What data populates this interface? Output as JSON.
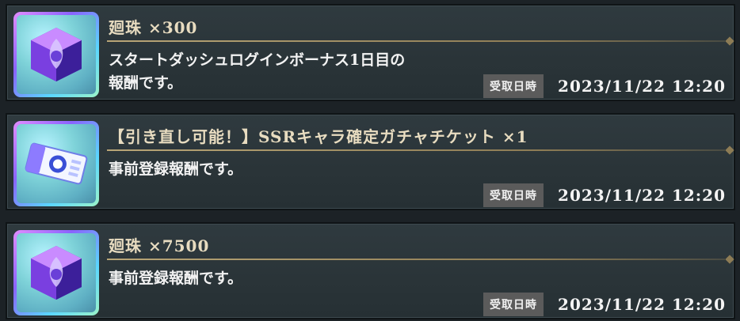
{
  "rewards": [
    {
      "title": "廻珠 ×300",
      "description": "スタートダッシュログインボーナス1日目の\n報酬です。",
      "date_label": "受取日時",
      "date": "2023/11/22 12:20",
      "icon": "purple-crystal-cube-icon"
    },
    {
      "title": "【引き直し可能！】SSRキャラ確定ガチャチケット ×1",
      "description": "事前登録報酬です。",
      "date_label": "受取日時",
      "date": "2023/11/22 12:20",
      "icon": "gacha-ticket-icon"
    },
    {
      "title": "廻珠 ×7500",
      "description": "事前登録報酬です。",
      "date_label": "受取日時",
      "date": "2023/11/22 12:20",
      "icon": "purple-crystal-cube-icon"
    }
  ],
  "colors": {
    "background": "#1c2226",
    "card": "#2f3a3f",
    "title_text": "#e8dcc0",
    "rule_gold": "#b9a677",
    "label_bg": "#5b5b5b"
  }
}
